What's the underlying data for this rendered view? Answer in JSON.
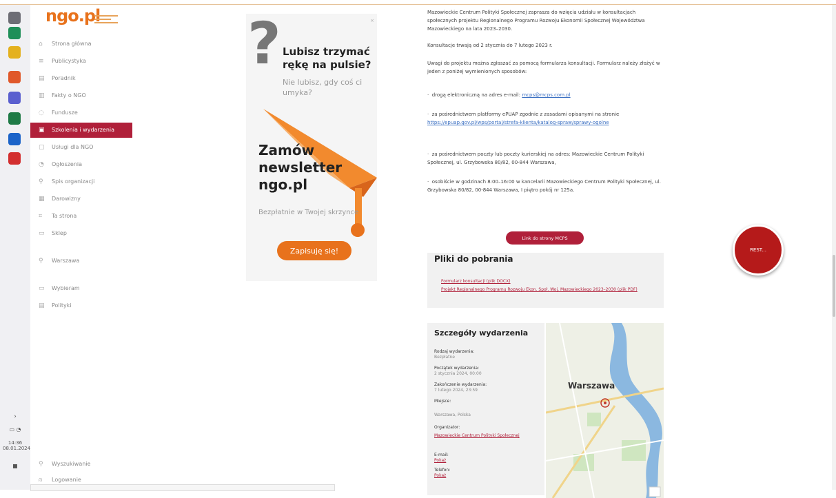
{
  "site": {
    "logo": "ngo.pl"
  },
  "taskbar": {
    "icons": [
      {
        "name": "widgets-icon",
        "color": "#6d6d75"
      },
      {
        "name": "edge-icon",
        "color": "#1f8f58"
      },
      {
        "name": "file-explorer-icon",
        "color": "#e4b11e"
      },
      {
        "name": "firefox-icon",
        "color": "#e0582a"
      },
      {
        "name": "teams-icon",
        "color": "#5a5fcf"
      },
      {
        "name": "excel-icon",
        "color": "#1f7a46"
      },
      {
        "name": "outlook-icon",
        "color": "#1b63c8"
      },
      {
        "name": "acrobat-icon",
        "color": "#d32f2f"
      }
    ],
    "time": "14:36",
    "date": "08.01.2024"
  },
  "nav": {
    "items": [
      {
        "label": "Strona główna",
        "icon": "⌂",
        "icon_name": "home-icon"
      },
      {
        "label": "Publicystyka",
        "icon": "≡",
        "icon_name": "article-icon"
      },
      {
        "label": "Poradnik",
        "icon": "▤",
        "icon_name": "guide-icon"
      },
      {
        "label": "Fakty o NGO",
        "icon": "▥",
        "icon_name": "facts-icon"
      },
      {
        "label": "Fundusze",
        "icon": "◌",
        "icon_name": "funds-icon"
      },
      {
        "label": "Szkolenia i wydarzenia",
        "icon": "▣",
        "icon_name": "calendar-icon",
        "active": true
      },
      {
        "label": "Usługi dla NGO",
        "icon": "▢",
        "icon_name": "services-icon"
      },
      {
        "label": "Ogłoszenia",
        "icon": "◔",
        "icon_name": "announcements-icon"
      },
      {
        "label": "Spis organizacji",
        "icon": "⚲",
        "icon_name": "directory-icon"
      },
      {
        "label": "Darowizny",
        "icon": "▦",
        "icon_name": "donations-icon"
      },
      {
        "label": "Ta strona",
        "icon": "⌗",
        "icon_name": "this-page-icon"
      },
      {
        "label": "Sklep",
        "icon": "▭",
        "icon_name": "shop-icon"
      }
    ],
    "local_items": [
      {
        "label": "Warszawa",
        "icon": "⚲",
        "icon_name": "location-icon"
      }
    ],
    "bottom_items": [
      {
        "label": "Wybieram",
        "icon": "▭",
        "icon_name": "monitor-icon"
      },
      {
        "label": "Polityki",
        "icon": "▤",
        "icon_name": "policies-icon"
      }
    ],
    "footer_items": [
      {
        "label": "Wyszukiwanie",
        "icon": "⚲",
        "icon_name": "search-icon"
      },
      {
        "label": "Logowanie",
        "icon": "⍝",
        "icon_name": "user-icon"
      }
    ]
  },
  "ad": {
    "heading1": "Lubisz trzymać rękę na pulsie?",
    "sub1": "Nie lubisz, gdy coś ci umyka?",
    "heading2": "Zamów newsletter ngo.pl",
    "sub2": "Bezpłatnie w Twojej skrzynce",
    "button": "Zapisuję się!"
  },
  "article": {
    "p1": "Mazowieckie Centrum Polityki Społecznej zaprasza do wzięcia udziału w konsultacjach społecznych projektu Regionalnego Programu Rozwoju Ekonomii Społecznej Województwa Mazowieckiego na lata 2023–2030.",
    "p2": "Konsultacje trwają od 2 stycznia do 7 lutego 2023 r.",
    "p3": "Uwagi do projektu można zgłaszać za pomocą formularza konsultacji. Formularz należy złożyć w jeden z poniżej wymienionych sposobów:",
    "b1_text": "drogą elektroniczną na adres e-mail: ",
    "b1_link": "mcps@mcps.com.pl",
    "b2_text": "za pośrednictwem platformy ePUAP zgodnie z zasadami opisanymi na stronie ",
    "b2_link": "https://epuap.gov.pl/wps/portal/strefa-klienta/katalog-spraw/sprawy-ogolne",
    "b3_text": "za pośrednictwem poczty lub poczty kurierskiej na adres: Mazowieckie Centrum Polityki Społecznej, ul. Grzybowska 80/82, 00-844 Warszawa,",
    "b4_text": "osobiście w godzinach 8:00–16:00 w kancelarii Mazowieckiego Centrum Polityki Społecznej, ul. Grzybowska 80/82, 00-844 Warszawa, I piętro pokój nr 125a.",
    "link_button": "Link do strony MCPS"
  },
  "files": {
    "title": "Pliki do pobrania",
    "items": [
      "Formularz konsultacji (plik DOCX)",
      "Projekt Regionalnego Programu Rozwoju Ekon. Społ. Woj. Mazowieckiego 2023–2030 (plik PDF)"
    ]
  },
  "details": {
    "title": "Szczegóły wydarzenia",
    "rows": [
      {
        "key": "Rodzaj wydarzenia:",
        "value": "Bezpłatne"
      },
      {
        "key": "Początek wydarzenia:",
        "value": "2 stycznia 2024, 00:00"
      },
      {
        "key": "Zakończenie wydarzenia:",
        "value": "7 lutego 2024, 23:59"
      },
      {
        "key": "Miejsce:",
        "value": "Warszawa, Polska"
      }
    ],
    "organizer_label": "Organizator:",
    "organizer": "Mazowieckie Centrum Polityki Społecznej",
    "email_label": "E-mail:",
    "email": "Pokaż",
    "phone_label": "Telefon:",
    "phone": "Pokaż"
  },
  "map": {
    "city": "Warszawa"
  },
  "record_button": "REST..."
}
